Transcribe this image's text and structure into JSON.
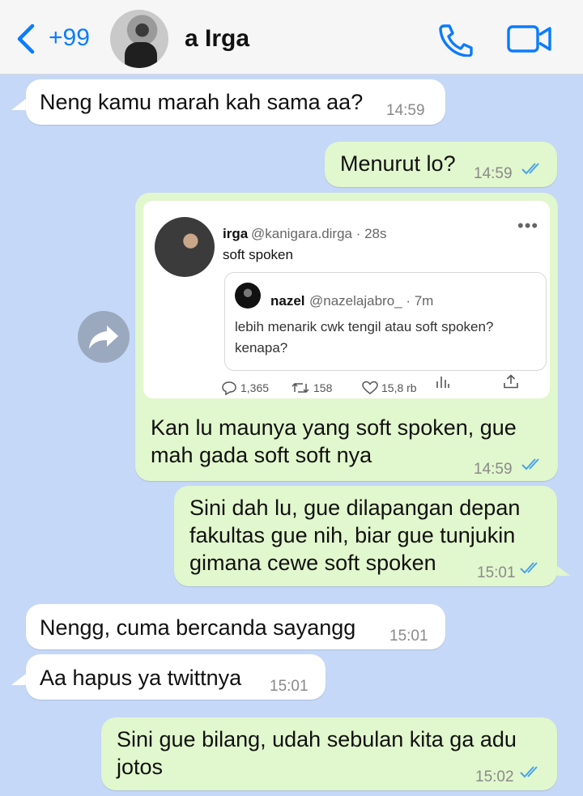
{
  "header": {
    "unread_count": "+99",
    "contact_name": "a Irga",
    "accent": "#0a7cff"
  },
  "messages": [
    {
      "text": "Neng kamu marah kah sama aa?",
      "time": "14:59",
      "direction": "incoming"
    },
    {
      "text": "Menurut lo?",
      "time": "14:59",
      "direction": "outgoing",
      "read": true
    },
    {
      "text_line1": "Kan lu maunya yang soft spoken, gue",
      "text_line2": "mah gada soft soft nya",
      "time": "14:59",
      "direction": "outgoing",
      "read": true
    },
    {
      "text_line1": "Sini dah lu, gue dilapangan depan",
      "text_line2": "fakultas gue nih, biar gue tunjukin",
      "text_line3": "gimana cewe soft spoken",
      "time": "15:01",
      "direction": "outgoing",
      "read": true
    },
    {
      "text": "Nengg, cuma bercanda sayangg",
      "time": "15:01",
      "direction": "incoming"
    },
    {
      "text": "Aa hapus ya twittnya",
      "time": "15:01",
      "direction": "incoming"
    },
    {
      "text_line1": "Sini gue bilang, udah sebulan kita ga adu",
      "text_line2": "jotos",
      "time": "15:02",
      "direction": "outgoing",
      "read": true
    }
  ],
  "tweet": {
    "author": "irga",
    "handle": "@kanigara.dirga · 28s",
    "text": "soft spoken",
    "quote": {
      "author": "nazel",
      "handle": "@nazelajabro_ · 7m",
      "text": "lebih menarik cwk tengil atau soft spoken? kenapa?"
    },
    "replies": "1,365",
    "reposts": "158",
    "likes": "15,8 rb"
  }
}
